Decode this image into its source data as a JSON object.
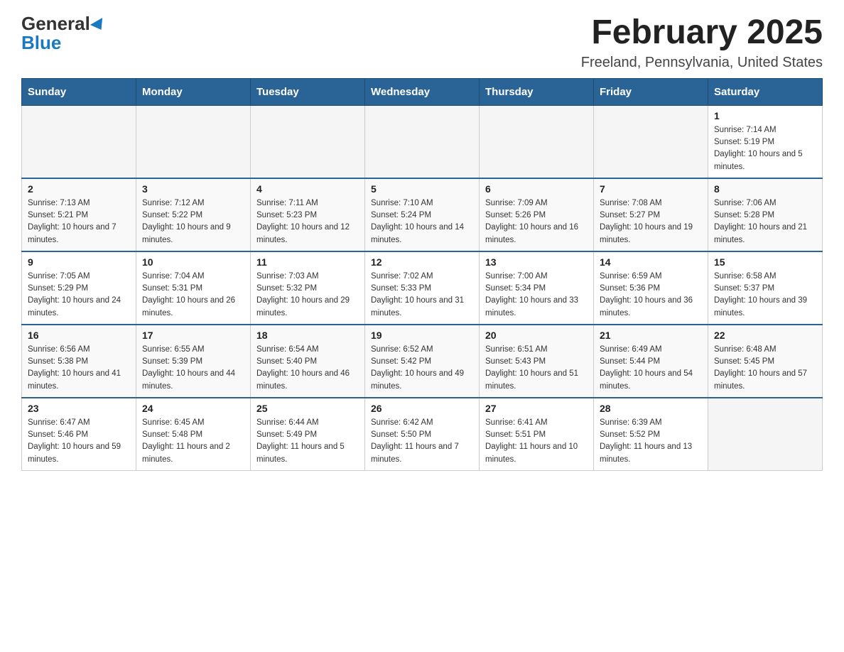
{
  "header": {
    "logo_general": "General",
    "logo_blue": "Blue",
    "month_title": "February 2025",
    "location": "Freeland, Pennsylvania, United States"
  },
  "weekdays": [
    "Sunday",
    "Monday",
    "Tuesday",
    "Wednesday",
    "Thursday",
    "Friday",
    "Saturday"
  ],
  "weeks": [
    [
      {
        "day": "",
        "info": ""
      },
      {
        "day": "",
        "info": ""
      },
      {
        "day": "",
        "info": ""
      },
      {
        "day": "",
        "info": ""
      },
      {
        "day": "",
        "info": ""
      },
      {
        "day": "",
        "info": ""
      },
      {
        "day": "1",
        "info": "Sunrise: 7:14 AM\nSunset: 5:19 PM\nDaylight: 10 hours and 5 minutes."
      }
    ],
    [
      {
        "day": "2",
        "info": "Sunrise: 7:13 AM\nSunset: 5:21 PM\nDaylight: 10 hours and 7 minutes."
      },
      {
        "day": "3",
        "info": "Sunrise: 7:12 AM\nSunset: 5:22 PM\nDaylight: 10 hours and 9 minutes."
      },
      {
        "day": "4",
        "info": "Sunrise: 7:11 AM\nSunset: 5:23 PM\nDaylight: 10 hours and 12 minutes."
      },
      {
        "day": "5",
        "info": "Sunrise: 7:10 AM\nSunset: 5:24 PM\nDaylight: 10 hours and 14 minutes."
      },
      {
        "day": "6",
        "info": "Sunrise: 7:09 AM\nSunset: 5:26 PM\nDaylight: 10 hours and 16 minutes."
      },
      {
        "day": "7",
        "info": "Sunrise: 7:08 AM\nSunset: 5:27 PM\nDaylight: 10 hours and 19 minutes."
      },
      {
        "day": "8",
        "info": "Sunrise: 7:06 AM\nSunset: 5:28 PM\nDaylight: 10 hours and 21 minutes."
      }
    ],
    [
      {
        "day": "9",
        "info": "Sunrise: 7:05 AM\nSunset: 5:29 PM\nDaylight: 10 hours and 24 minutes."
      },
      {
        "day": "10",
        "info": "Sunrise: 7:04 AM\nSunset: 5:31 PM\nDaylight: 10 hours and 26 minutes."
      },
      {
        "day": "11",
        "info": "Sunrise: 7:03 AM\nSunset: 5:32 PM\nDaylight: 10 hours and 29 minutes."
      },
      {
        "day": "12",
        "info": "Sunrise: 7:02 AM\nSunset: 5:33 PM\nDaylight: 10 hours and 31 minutes."
      },
      {
        "day": "13",
        "info": "Sunrise: 7:00 AM\nSunset: 5:34 PM\nDaylight: 10 hours and 33 minutes."
      },
      {
        "day": "14",
        "info": "Sunrise: 6:59 AM\nSunset: 5:36 PM\nDaylight: 10 hours and 36 minutes."
      },
      {
        "day": "15",
        "info": "Sunrise: 6:58 AM\nSunset: 5:37 PM\nDaylight: 10 hours and 39 minutes."
      }
    ],
    [
      {
        "day": "16",
        "info": "Sunrise: 6:56 AM\nSunset: 5:38 PM\nDaylight: 10 hours and 41 minutes."
      },
      {
        "day": "17",
        "info": "Sunrise: 6:55 AM\nSunset: 5:39 PM\nDaylight: 10 hours and 44 minutes."
      },
      {
        "day": "18",
        "info": "Sunrise: 6:54 AM\nSunset: 5:40 PM\nDaylight: 10 hours and 46 minutes."
      },
      {
        "day": "19",
        "info": "Sunrise: 6:52 AM\nSunset: 5:42 PM\nDaylight: 10 hours and 49 minutes."
      },
      {
        "day": "20",
        "info": "Sunrise: 6:51 AM\nSunset: 5:43 PM\nDaylight: 10 hours and 51 minutes."
      },
      {
        "day": "21",
        "info": "Sunrise: 6:49 AM\nSunset: 5:44 PM\nDaylight: 10 hours and 54 minutes."
      },
      {
        "day": "22",
        "info": "Sunrise: 6:48 AM\nSunset: 5:45 PM\nDaylight: 10 hours and 57 minutes."
      }
    ],
    [
      {
        "day": "23",
        "info": "Sunrise: 6:47 AM\nSunset: 5:46 PM\nDaylight: 10 hours and 59 minutes."
      },
      {
        "day": "24",
        "info": "Sunrise: 6:45 AM\nSunset: 5:48 PM\nDaylight: 11 hours and 2 minutes."
      },
      {
        "day": "25",
        "info": "Sunrise: 6:44 AM\nSunset: 5:49 PM\nDaylight: 11 hours and 5 minutes."
      },
      {
        "day": "26",
        "info": "Sunrise: 6:42 AM\nSunset: 5:50 PM\nDaylight: 11 hours and 7 minutes."
      },
      {
        "day": "27",
        "info": "Sunrise: 6:41 AM\nSunset: 5:51 PM\nDaylight: 11 hours and 10 minutes."
      },
      {
        "day": "28",
        "info": "Sunrise: 6:39 AM\nSunset: 5:52 PM\nDaylight: 11 hours and 13 minutes."
      },
      {
        "day": "",
        "info": ""
      }
    ]
  ]
}
